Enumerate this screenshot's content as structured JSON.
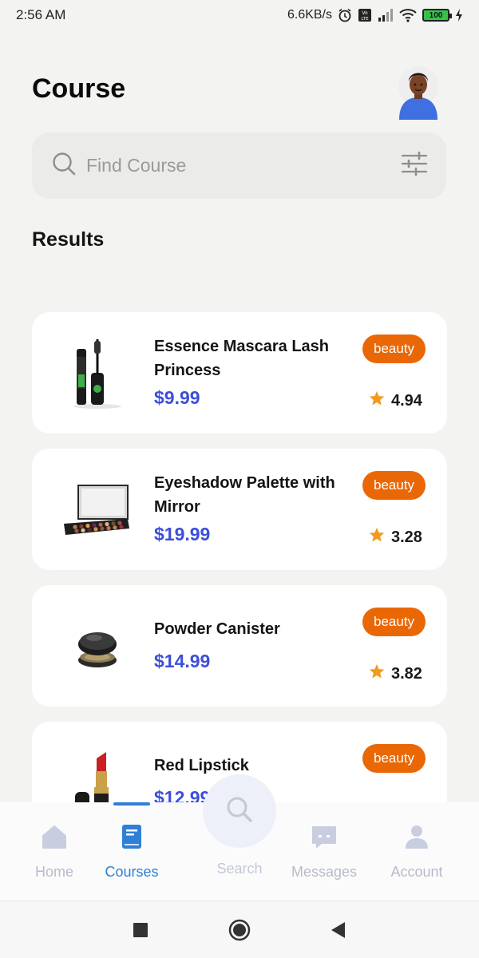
{
  "status_bar": {
    "time": "2:56 AM",
    "net_speed": "6.6KB/s",
    "battery": "100"
  },
  "header": {
    "title": "Course"
  },
  "search": {
    "placeholder": "Find Course"
  },
  "results": {
    "title": "Results",
    "items": [
      {
        "title": "Essence Mascara Lash Princess",
        "price": "$9.99",
        "category": "beauty",
        "rating": "4.94",
        "image": "mascara"
      },
      {
        "title": "Eyeshadow Palette with Mirror",
        "price": "$19.99",
        "category": "beauty",
        "rating": "3.28",
        "image": "eyeshadow-palette"
      },
      {
        "title": "Powder Canister",
        "price": "$14.99",
        "category": "beauty",
        "rating": "3.82",
        "image": "powder-canister"
      },
      {
        "title": "Red Lipstick",
        "price": "$12.99",
        "category": "beauty",
        "rating": "",
        "image": "lipstick"
      }
    ]
  },
  "bottom_nav": {
    "items": [
      {
        "label": "Home",
        "icon": "home-icon",
        "active": false
      },
      {
        "label": "Courses",
        "icon": "book-icon",
        "active": true
      },
      {
        "label": "Search",
        "icon": "search-icon",
        "active": false
      },
      {
        "label": "Messages",
        "icon": "chat-icon",
        "active": false
      },
      {
        "label": "Account",
        "icon": "person-icon",
        "active": false
      }
    ]
  },
  "colors": {
    "accent": "#2f7fd6",
    "price": "#3c4fd8",
    "badge": "#ea6706",
    "star": "#f39a1d"
  }
}
